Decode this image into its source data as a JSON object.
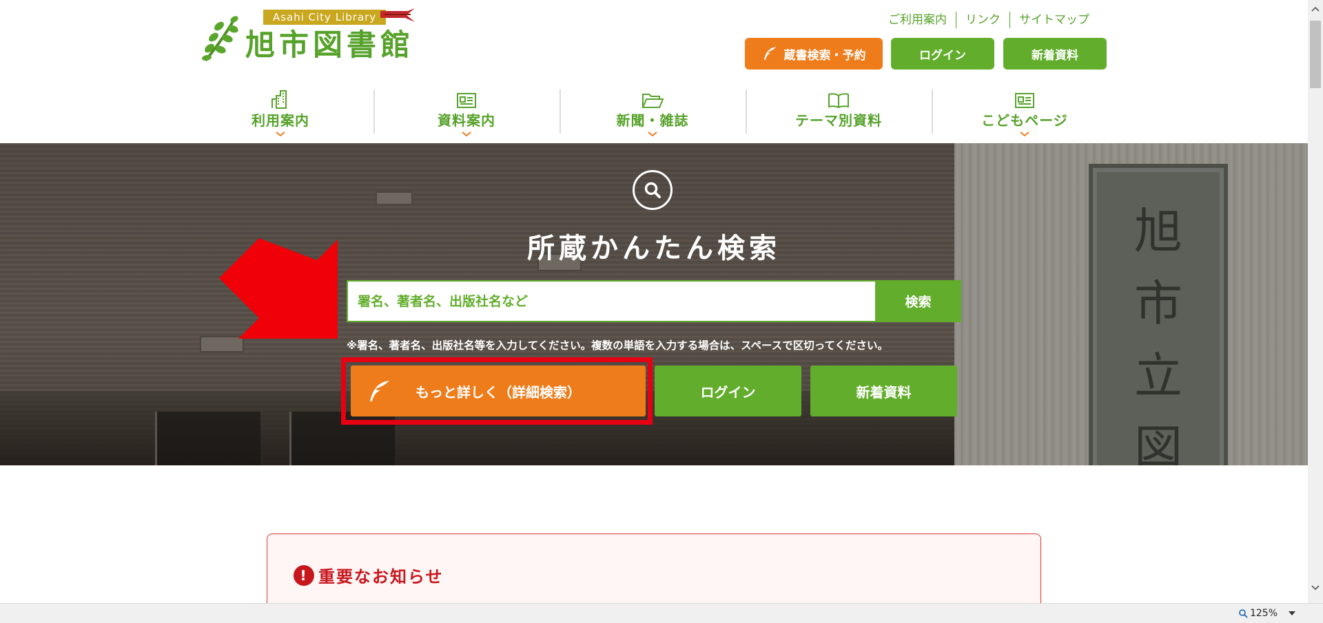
{
  "header": {
    "logo_banner": "Asahi City Library",
    "logo_title": "旭市図書館",
    "util_links": [
      "ご利用案内",
      "リンク",
      "サイトマップ"
    ],
    "buttons": {
      "catalog": "蔵書検索・予約",
      "login": "ログイン",
      "new_items": "新着資料"
    }
  },
  "nav": {
    "items": [
      {
        "label": "利用案内",
        "icon": "building-icon",
        "has_dropdown": true
      },
      {
        "label": "資料案内",
        "icon": "newspaper-icon",
        "has_dropdown": true
      },
      {
        "label": "新聞・雑誌",
        "icon": "folder-open-icon",
        "has_dropdown": true
      },
      {
        "label": "テーマ別資料",
        "icon": "book-open-icon",
        "has_dropdown": false
      },
      {
        "label": "こどもページ",
        "icon": "news-card-icon",
        "has_dropdown": true
      }
    ]
  },
  "hero": {
    "title": "所蔵かんたん検索",
    "search_placeholder": "署名、著者名、出版社名など",
    "search_button": "検索",
    "note": "※署名、著者名、出版社名等を入力してください。複数の単語を入力する場合は、スペースで区切ってください。",
    "buttons": {
      "advanced": "もっと詳しく（詳細検索）",
      "login": "ログイン",
      "new_items": "新着資料"
    },
    "plaque_text": "旭市立図書"
  },
  "notice": {
    "title": "重要なお知らせ"
  },
  "status": {
    "zoom": "125%"
  },
  "colors": {
    "brand_green": "#62ad2c",
    "brand_orange": "#ef7c1b",
    "highlight_red": "#e60012",
    "notice_red": "#c8161d"
  }
}
